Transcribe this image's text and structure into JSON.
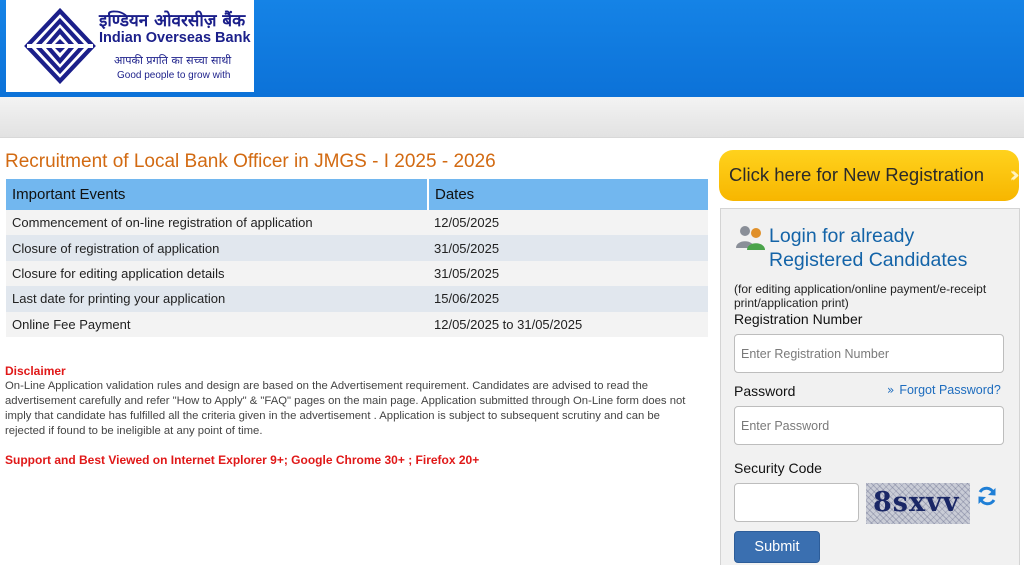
{
  "header": {
    "logo": {
      "hindi_name": "इण्डियन ओवरसीज़ बैंक",
      "english_name": "Indian Overseas Bank",
      "tagline_hindi": "आपकी प्रगति का सच्चा साथी",
      "tagline_english": "Good people to grow with",
      "icon": "iob-logo-mark"
    }
  },
  "main": {
    "title": "Recruitment of Local Bank Officer in JMGS - I 2025 - 2026",
    "events_table": {
      "headers": [
        "Important Events",
        "Dates"
      ],
      "rows": [
        {
          "event": "Commencement of on-line registration of application",
          "date": "12/05/2025"
        },
        {
          "event": "Closure of registration of application",
          "date": "31/05/2025"
        },
        {
          "event": "Closure for editing application details",
          "date": "31/05/2025"
        },
        {
          "event": "Last date for printing your application",
          "date": "15/06/2025"
        },
        {
          "event": "Online Fee Payment",
          "date": "12/05/2025 to 31/05/2025"
        }
      ]
    },
    "disclaimer": {
      "title": "Disclaimer",
      "text": "On-Line Application validation rules and design are based on the Advertisement requirement. Candidates are advised to read the advertisement carefully and refer \"How to Apply\" & \"FAQ\" pages on the main page. Application submitted through On-Line form does not imply that candidate has fulfilled all the criteria given in the advertisement . Application is subject to subsequent scrutiny and can be rejected if found to be ineligible at any point of time."
    },
    "support_text": "Support and Best Viewed on Internet Explorer 9+; Google Chrome 30+ ; Firefox 20+"
  },
  "sidebar": {
    "new_registration": {
      "label": "Click here for New Registration",
      "icon": "double-chevron-right-icon"
    },
    "login": {
      "heading_line1": "Login for already",
      "heading_line2": "Registered Candidates",
      "subtitle": "(for editing application/online payment/e-receipt print/application print)",
      "registration_label": "Registration Number",
      "registration_placeholder": "Enter Registration Number",
      "password_label": "Password",
      "password_placeholder": "Enter Password",
      "forgot_password": "Forgot Password?",
      "security_label": "Security Code",
      "captcha_text": "8sxvv",
      "submit_label": "Submit"
    }
  },
  "colors": {
    "header_blue": "#0c72d8",
    "title_orange": "#d26a12",
    "table_header": "#72b7ef",
    "cta_yellow": "#f7b600",
    "disclaimer_red": "#e01818",
    "link_blue": "#1d6cbe",
    "submit_blue": "#3a6fb0"
  }
}
